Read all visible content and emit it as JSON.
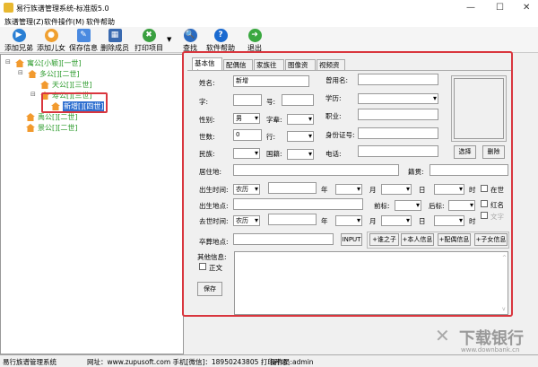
{
  "window": {
    "title": "易行族谱管理系统-标准版5.0",
    "min": "—",
    "max": "☐",
    "close": "✕"
  },
  "menu": [
    "族谱管理(Z)",
    "软件操作(M)",
    "软件帮助"
  ],
  "toolbar": [
    {
      "label": "添加兄弟",
      "icon": "play-icon",
      "color": "#2a7fd4"
    },
    {
      "label": "添加儿女",
      "icon": "person-icon",
      "color": "#f0a030"
    },
    {
      "label": "保存信息",
      "icon": "pen-icon",
      "color": "#4a8ae0"
    },
    {
      "label": "删除成员",
      "icon": "grid-icon",
      "color": "#3a6ab0"
    },
    {
      "label": "打印项目",
      "icon": "tools-icon",
      "color": "#3aa040"
    },
    {
      "label": "查找",
      "icon": "search-icon",
      "color": "#2a6ac0"
    },
    {
      "label": "软件帮助",
      "icon": "help-icon",
      "color": "#1a6ad0"
    },
    {
      "label": "退出",
      "icon": "exit-arrow-icon",
      "color": "#3aa840"
    }
  ],
  "tree": [
    "寓公[小颖][一世]",
    "多公[][二世]",
    "天公[][三世]",
    "寿公[][三世]",
    "新增[][四世]",
    "禹公[][二世]",
    "景公[][二世]"
  ],
  "tabs": [
    "基本信息",
    "配偶信息",
    "家族往事",
    "图像资料",
    "视频资料"
  ],
  "form": {
    "name_label": "姓名:",
    "name_value": "新增",
    "alias_label": "曾用名:",
    "zi_label": "字:",
    "hao_label": "号:",
    "edu_label": "学历:",
    "sex_label": "性别:",
    "sex_value": "男",
    "bei_label": "字辈:",
    "job_label": "职业:",
    "gen_label": "世数:",
    "gen_value": "0",
    "hang_label": "行:",
    "id_label": "身份证号:",
    "nation_label": "民族:",
    "country_label": "国籍:",
    "phone_label": "电话:",
    "select_btn": "选择",
    "delete_btn": "删除",
    "addr_label": "居住地:",
    "origin_label": "籍贯:",
    "birth_label": "出生时间:",
    "cal_value": "农历",
    "year": "年",
    "month": "月",
    "day": "日",
    "hour": "时",
    "alive": "在世",
    "birthplace_label": "出生地点:",
    "prefix_label": "前标:",
    "suffix_label": "后标:",
    "redname": "红名",
    "death_label": "去世时间:",
    "text_cb": "文字",
    "burial_label": "卒葬地点:",
    "input_btn": "INPUT",
    "b1": "+谁之子",
    "b2": "+本人信息",
    "b3": "+配偶信息",
    "b4": "+子女信息",
    "other_label": "其他信息:",
    "zhengwen": "正文",
    "save_btn": "保存"
  },
  "status": {
    "app": "易行族谱管理系统",
    "contact": "网址：www.zupusoft.com 手机[微信]：18950243805 打印开通",
    "operator": "操作员:admin"
  },
  "watermark": {
    "text": "下载银行",
    "url": "www.downbank.cn"
  }
}
